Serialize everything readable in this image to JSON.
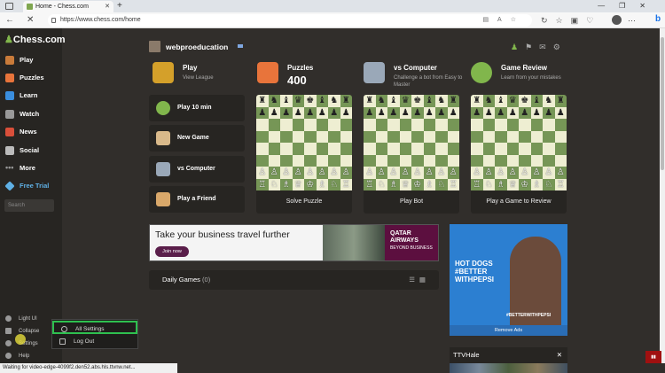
{
  "browser": {
    "tab_title": "Home - Chess.com",
    "url": "https://www.chess.com/home",
    "status": "Waiting for video-edge-4099f2.den52.abs.hls.ttvnw.net..."
  },
  "sidebar": {
    "logo": "Chess.com",
    "items": [
      {
        "label": "Play",
        "color": "#c97b3a"
      },
      {
        "label": "Puzzles",
        "color": "#e8743b"
      },
      {
        "label": "Learn",
        "color": "#3a8ede"
      },
      {
        "label": "Watch",
        "color": "#999999"
      },
      {
        "label": "News",
        "color": "#d94f3a"
      },
      {
        "label": "Social",
        "color": "#bbbbbb"
      },
      {
        "label": "More",
        "color": "#999999"
      },
      {
        "label": "Free Trial",
        "color": "#5fb0e5"
      }
    ],
    "search_placeholder": "Search",
    "bottom": {
      "light_ui": "Light UI",
      "collapse": "Collapse",
      "settings": "Settings",
      "help": "Help"
    }
  },
  "settings_menu": {
    "all_settings": "All Settings",
    "log_out": "Log Out"
  },
  "profile": {
    "username": "webproeducation"
  },
  "features": [
    {
      "title": "Play",
      "subtitle": "View League",
      "color": "#d4a02a"
    },
    {
      "title": "Puzzles",
      "value": "400",
      "color": "#e8743b"
    },
    {
      "title": "vs Computer",
      "subtitle": "Challenge a bot from Easy to Master",
      "color": "#9aa8b8"
    },
    {
      "title": "Game Review",
      "subtitle": "Learn from your mistakes",
      "color": "#81b64c"
    }
  ],
  "quick_buttons": [
    {
      "label": "Play 10 min",
      "color": "#81b64c"
    },
    {
      "label": "New Game",
      "color": "#d9b98a"
    },
    {
      "label": "vs Computer",
      "color": "#9aa8b8"
    },
    {
      "label": "Play a Friend",
      "color": "#d9a86a"
    }
  ],
  "cards": [
    {
      "label": "Solve Puzzle"
    },
    {
      "label": "Play Bot"
    },
    {
      "label": "Play a Game to Review"
    }
  ],
  "ad": {
    "headline": "Take your business travel further",
    "button": "Join now",
    "brand": "QATAR AIRWAYS",
    "brand_sub": "BEYOND BUSINESS"
  },
  "daily": {
    "title": "Daily Games",
    "count": "(0)"
  },
  "side_ad": {
    "text": "HOT DOGS #BETTER WITHPEPSI",
    "tag": "#BETTERWITHPEPSI",
    "remove": "Remove Ads"
  },
  "stream": {
    "name": "TTVHale"
  }
}
